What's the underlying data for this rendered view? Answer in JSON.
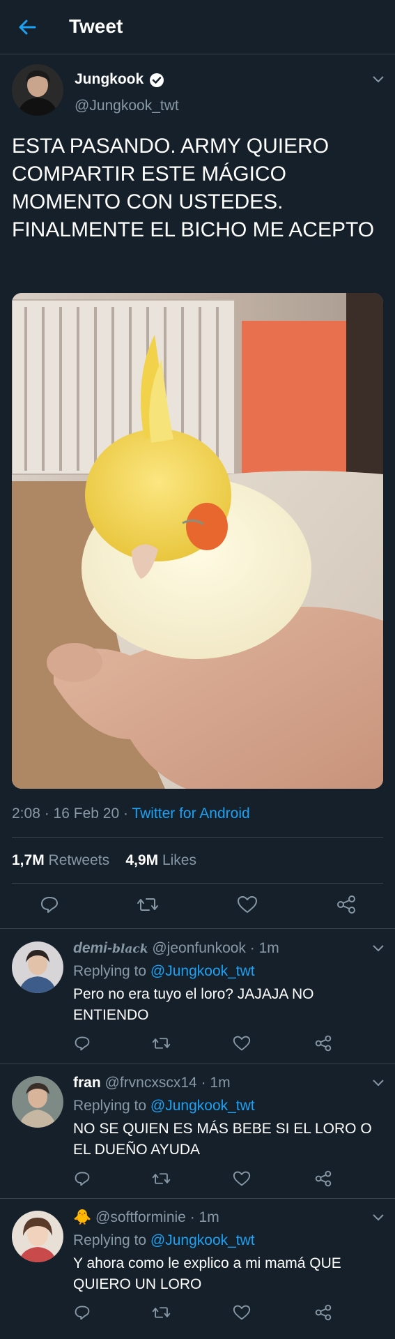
{
  "header": {
    "title": "Tweet"
  },
  "tweet": {
    "author_name": "Jungkook",
    "author_handle": "@Jungkook_twt",
    "text": "ESTA PASANDO. ARMY QUIERO COMPARTIR ESTE MÁGICO MOMENTO CON USTEDES. FINALMENTE EL BICHO ME ACEPTO",
    "time": "2:08",
    "date": "16 Feb 20",
    "source": "Twitter for Android",
    "retweets_count": "1,7M",
    "retweets_label": "Retweets",
    "likes_count": "4,9M",
    "likes_label": "Likes"
  },
  "replies": [
    {
      "name": "demi-",
      "name_suffix": "black",
      "handle": "@jeonfunkook",
      "time": "1m",
      "replying_prefix": "Replying to",
      "mention": "@Jungkook_twt",
      "text": "Pero no era tuyo el loro? JAJAJA NO ENTIENDO"
    },
    {
      "name": "fran",
      "handle": "@frvncxscx14",
      "time": "1m",
      "replying_prefix": "Replying to",
      "mention": "@Jungkook_twt",
      "text": "NO SE QUIEN ES MÁS BEBE SI EL LORO O EL DUEÑO AYUDA"
    },
    {
      "name": "🐥",
      "handle": "@softforminie",
      "time": "1m",
      "replying_prefix": "Replying to",
      "mention": "@Jungkook_twt",
      "text": "Y ahora como le explico a mi mamá QUE QUIERO UN LORO"
    }
  ],
  "colors": {
    "background": "#15202b",
    "accent": "#1da1f2",
    "secondary_text": "#8899a6",
    "divider": "#38444d"
  }
}
